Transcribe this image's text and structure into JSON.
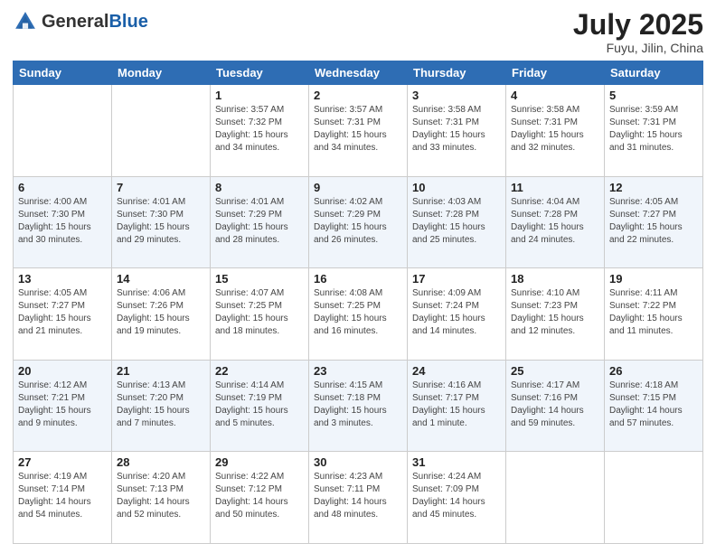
{
  "logo": {
    "general": "General",
    "blue": "Blue"
  },
  "header": {
    "month": "July 2025",
    "location": "Fuyu, Jilin, China"
  },
  "weekdays": [
    "Sunday",
    "Monday",
    "Tuesday",
    "Wednesday",
    "Thursday",
    "Friday",
    "Saturday"
  ],
  "weeks": [
    [
      {
        "day": "",
        "sunrise": "",
        "sunset": "",
        "daylight": ""
      },
      {
        "day": "",
        "sunrise": "",
        "sunset": "",
        "daylight": ""
      },
      {
        "day": "1",
        "sunrise": "Sunrise: 3:57 AM",
        "sunset": "Sunset: 7:32 PM",
        "daylight": "Daylight: 15 hours and 34 minutes."
      },
      {
        "day": "2",
        "sunrise": "Sunrise: 3:57 AM",
        "sunset": "Sunset: 7:31 PM",
        "daylight": "Daylight: 15 hours and 34 minutes."
      },
      {
        "day": "3",
        "sunrise": "Sunrise: 3:58 AM",
        "sunset": "Sunset: 7:31 PM",
        "daylight": "Daylight: 15 hours and 33 minutes."
      },
      {
        "day": "4",
        "sunrise": "Sunrise: 3:58 AM",
        "sunset": "Sunset: 7:31 PM",
        "daylight": "Daylight: 15 hours and 32 minutes."
      },
      {
        "day": "5",
        "sunrise": "Sunrise: 3:59 AM",
        "sunset": "Sunset: 7:31 PM",
        "daylight": "Daylight: 15 hours and 31 minutes."
      }
    ],
    [
      {
        "day": "6",
        "sunrise": "Sunrise: 4:00 AM",
        "sunset": "Sunset: 7:30 PM",
        "daylight": "Daylight: 15 hours and 30 minutes."
      },
      {
        "day": "7",
        "sunrise": "Sunrise: 4:01 AM",
        "sunset": "Sunset: 7:30 PM",
        "daylight": "Daylight: 15 hours and 29 minutes."
      },
      {
        "day": "8",
        "sunrise": "Sunrise: 4:01 AM",
        "sunset": "Sunset: 7:29 PM",
        "daylight": "Daylight: 15 hours and 28 minutes."
      },
      {
        "day": "9",
        "sunrise": "Sunrise: 4:02 AM",
        "sunset": "Sunset: 7:29 PM",
        "daylight": "Daylight: 15 hours and 26 minutes."
      },
      {
        "day": "10",
        "sunrise": "Sunrise: 4:03 AM",
        "sunset": "Sunset: 7:28 PM",
        "daylight": "Daylight: 15 hours and 25 minutes."
      },
      {
        "day": "11",
        "sunrise": "Sunrise: 4:04 AM",
        "sunset": "Sunset: 7:28 PM",
        "daylight": "Daylight: 15 hours and 24 minutes."
      },
      {
        "day": "12",
        "sunrise": "Sunrise: 4:05 AM",
        "sunset": "Sunset: 7:27 PM",
        "daylight": "Daylight: 15 hours and 22 minutes."
      }
    ],
    [
      {
        "day": "13",
        "sunrise": "Sunrise: 4:05 AM",
        "sunset": "Sunset: 7:27 PM",
        "daylight": "Daylight: 15 hours and 21 minutes."
      },
      {
        "day": "14",
        "sunrise": "Sunrise: 4:06 AM",
        "sunset": "Sunset: 7:26 PM",
        "daylight": "Daylight: 15 hours and 19 minutes."
      },
      {
        "day": "15",
        "sunrise": "Sunrise: 4:07 AM",
        "sunset": "Sunset: 7:25 PM",
        "daylight": "Daylight: 15 hours and 18 minutes."
      },
      {
        "day": "16",
        "sunrise": "Sunrise: 4:08 AM",
        "sunset": "Sunset: 7:25 PM",
        "daylight": "Daylight: 15 hours and 16 minutes."
      },
      {
        "day": "17",
        "sunrise": "Sunrise: 4:09 AM",
        "sunset": "Sunset: 7:24 PM",
        "daylight": "Daylight: 15 hours and 14 minutes."
      },
      {
        "day": "18",
        "sunrise": "Sunrise: 4:10 AM",
        "sunset": "Sunset: 7:23 PM",
        "daylight": "Daylight: 15 hours and 12 minutes."
      },
      {
        "day": "19",
        "sunrise": "Sunrise: 4:11 AM",
        "sunset": "Sunset: 7:22 PM",
        "daylight": "Daylight: 15 hours and 11 minutes."
      }
    ],
    [
      {
        "day": "20",
        "sunrise": "Sunrise: 4:12 AM",
        "sunset": "Sunset: 7:21 PM",
        "daylight": "Daylight: 15 hours and 9 minutes."
      },
      {
        "day": "21",
        "sunrise": "Sunrise: 4:13 AM",
        "sunset": "Sunset: 7:20 PM",
        "daylight": "Daylight: 15 hours and 7 minutes."
      },
      {
        "day": "22",
        "sunrise": "Sunrise: 4:14 AM",
        "sunset": "Sunset: 7:19 PM",
        "daylight": "Daylight: 15 hours and 5 minutes."
      },
      {
        "day": "23",
        "sunrise": "Sunrise: 4:15 AM",
        "sunset": "Sunset: 7:18 PM",
        "daylight": "Daylight: 15 hours and 3 minutes."
      },
      {
        "day": "24",
        "sunrise": "Sunrise: 4:16 AM",
        "sunset": "Sunset: 7:17 PM",
        "daylight": "Daylight: 15 hours and 1 minute."
      },
      {
        "day": "25",
        "sunrise": "Sunrise: 4:17 AM",
        "sunset": "Sunset: 7:16 PM",
        "daylight": "Daylight: 14 hours and 59 minutes."
      },
      {
        "day": "26",
        "sunrise": "Sunrise: 4:18 AM",
        "sunset": "Sunset: 7:15 PM",
        "daylight": "Daylight: 14 hours and 57 minutes."
      }
    ],
    [
      {
        "day": "27",
        "sunrise": "Sunrise: 4:19 AM",
        "sunset": "Sunset: 7:14 PM",
        "daylight": "Daylight: 14 hours and 54 minutes."
      },
      {
        "day": "28",
        "sunrise": "Sunrise: 4:20 AM",
        "sunset": "Sunset: 7:13 PM",
        "daylight": "Daylight: 14 hours and 52 minutes."
      },
      {
        "day": "29",
        "sunrise": "Sunrise: 4:22 AM",
        "sunset": "Sunset: 7:12 PM",
        "daylight": "Daylight: 14 hours and 50 minutes."
      },
      {
        "day": "30",
        "sunrise": "Sunrise: 4:23 AM",
        "sunset": "Sunset: 7:11 PM",
        "daylight": "Daylight: 14 hours and 48 minutes."
      },
      {
        "day": "31",
        "sunrise": "Sunrise: 4:24 AM",
        "sunset": "Sunset: 7:09 PM",
        "daylight": "Daylight: 14 hours and 45 minutes."
      },
      {
        "day": "",
        "sunrise": "",
        "sunset": "",
        "daylight": ""
      },
      {
        "day": "",
        "sunrise": "",
        "sunset": "",
        "daylight": ""
      }
    ]
  ]
}
